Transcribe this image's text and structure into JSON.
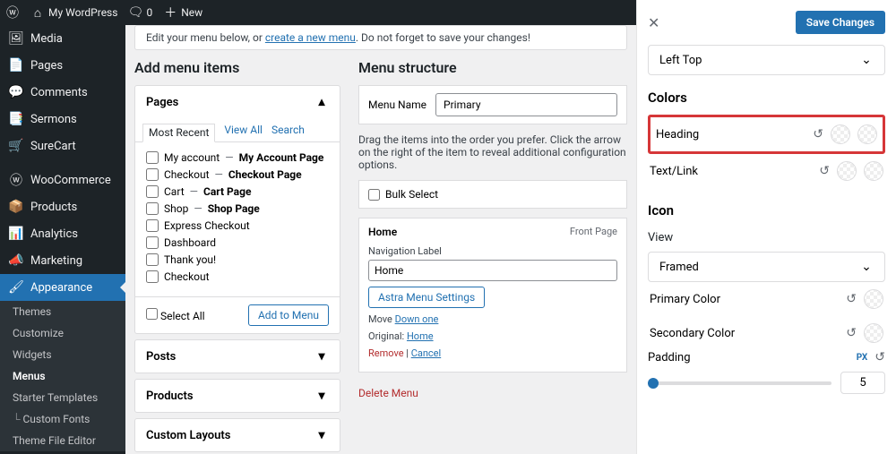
{
  "toolbar": {
    "site": "My WordPress",
    "comments": "0",
    "new": "New"
  },
  "sidemenu": {
    "items": [
      {
        "label": "Media",
        "icon": "🖼"
      },
      {
        "label": "Pages",
        "icon": "📄"
      },
      {
        "label": "Comments",
        "icon": "💬"
      },
      {
        "label": "Sermons",
        "icon": "📑"
      },
      {
        "label": "SureCart",
        "icon": "🛒"
      },
      {
        "label": "WooCommerce",
        "icon": "ⓦ"
      },
      {
        "label": "Products",
        "icon": "📦"
      },
      {
        "label": "Analytics",
        "icon": "📊"
      },
      {
        "label": "Marketing",
        "icon": "📣"
      },
      {
        "label": "Appearance",
        "icon": "🖌"
      }
    ],
    "sub": [
      "Themes",
      "Customize",
      "Widgets",
      "Menus",
      "Starter Templates",
      "Custom Fonts",
      "Theme File Editor"
    ]
  },
  "notice": {
    "prefix": "Edit your menu below, or ",
    "link": "create a new menu",
    "suffix": ". Do not forget to save your changes!"
  },
  "left": {
    "title": "Add menu items",
    "acc_pages": "Pages",
    "tabs": {
      "recent": "Most Recent",
      "all": "View All",
      "search": "Search"
    },
    "pages": [
      {
        "name": "My account",
        "alt": "My Account Page"
      },
      {
        "name": "Checkout",
        "alt": "Checkout Page"
      },
      {
        "name": "Cart",
        "alt": "Cart Page"
      },
      {
        "name": "Shop",
        "alt": "Shop Page"
      },
      {
        "name": "Express Checkout",
        "alt": ""
      },
      {
        "name": "Dashboard",
        "alt": ""
      },
      {
        "name": "Thank you!",
        "alt": ""
      },
      {
        "name": "Checkout",
        "alt": ""
      }
    ],
    "select_all": "Select All",
    "add_btn": "Add to Menu",
    "acc_posts": "Posts",
    "acc_products": "Products",
    "acc_custom": "Custom Layouts"
  },
  "right": {
    "title": "Menu structure",
    "name_label": "Menu Name",
    "name_value": "Primary",
    "hint": "Drag the items into the order you prefer. Click the arrow on the right of the item to reveal additional configuration options.",
    "bulk": "Bulk Select",
    "item": {
      "title": "Home",
      "tag": "Front Page",
      "nav_label": "Navigation Label",
      "nav_value": "Home",
      "astra_btn": "Astra Menu Settings",
      "move": "Move",
      "down": "Down one",
      "orig": "Original:",
      "orig_link": "Home",
      "remove": "Remove",
      "cancel": "Cancel"
    },
    "delete": "Delete Menu"
  },
  "panel": {
    "save": "Save Changes",
    "position": "Left Top",
    "sec_colors": "Colors",
    "heading": "Heading",
    "textlink": "Text/Link",
    "sec_icon": "Icon",
    "view_lbl": "View",
    "view_val": "Framed",
    "primary": "Primary Color",
    "secondary": "Secondary Color",
    "padding": "Padding",
    "px": "PX",
    "pad_val": "5"
  }
}
